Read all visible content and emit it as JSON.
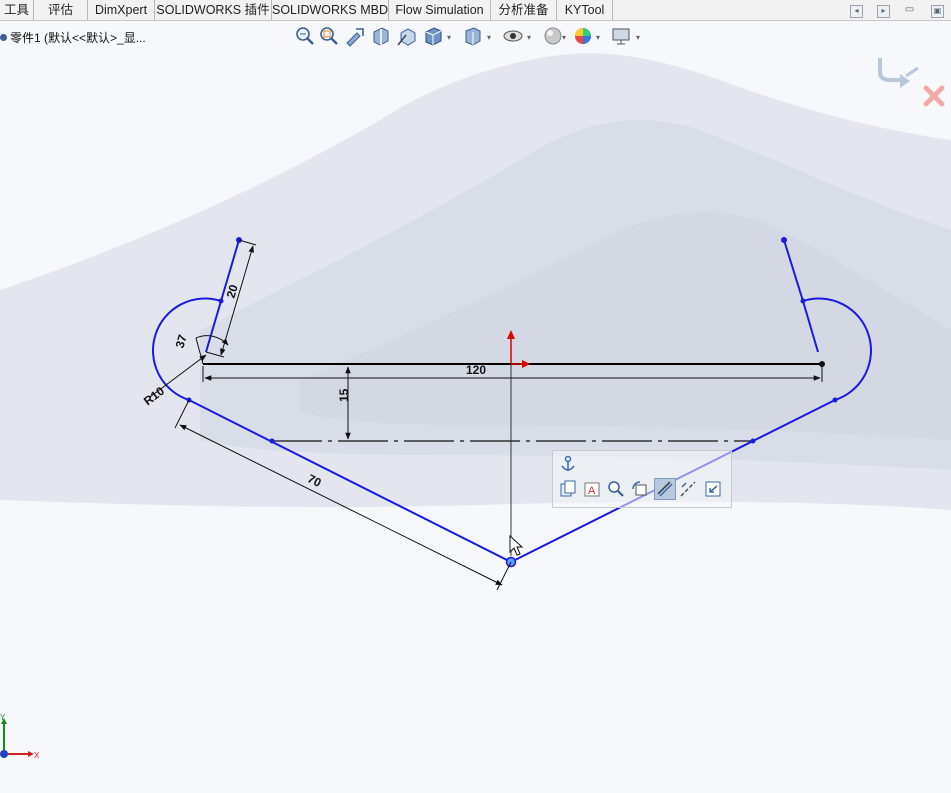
{
  "menu_tabs": [
    {
      "label": "工具"
    },
    {
      "label": "评估"
    },
    {
      "label": "DimXpert"
    },
    {
      "label": "SOLIDWORKS 插件"
    },
    {
      "label": "SOLIDWORKS MBD"
    },
    {
      "label": "Flow Simulation"
    },
    {
      "label": "分析准备"
    },
    {
      "label": "KYTool"
    }
  ],
  "tree": {
    "label": "零件1  (默认<<默认>_显..."
  },
  "dimensions": {
    "width": "120",
    "height": "15",
    "slant_length": "70",
    "arm_length": "20",
    "angle": "37",
    "radius": "R10"
  },
  "triad": {
    "x_label": "X",
    "y_label": "Y"
  },
  "colors": {
    "sketch_line": "#1a1ae0",
    "dimension": "#111111",
    "origin": "#e00000",
    "accent": "#2b6fd6"
  },
  "heads_up_icons": [
    "zoom-to-fit-icon",
    "zoom-to-area-icon",
    "previous-view-icon",
    "section-view-icon",
    "view-orientation-icon",
    "display-style-icon",
    "hide-show-items-icon",
    "edit-appearance-icon",
    "apply-scene-icon",
    "view-settings-icon"
  ],
  "context_toolbar_icons": [
    "fix-relation-icon",
    "copy-entities-icon",
    "sketch-text-icon",
    "zoom-to-selection-icon",
    "rotate-entity-icon",
    "smart-dimension-icon",
    "construction-geometry-icon",
    "exit-sketch-icon"
  ]
}
